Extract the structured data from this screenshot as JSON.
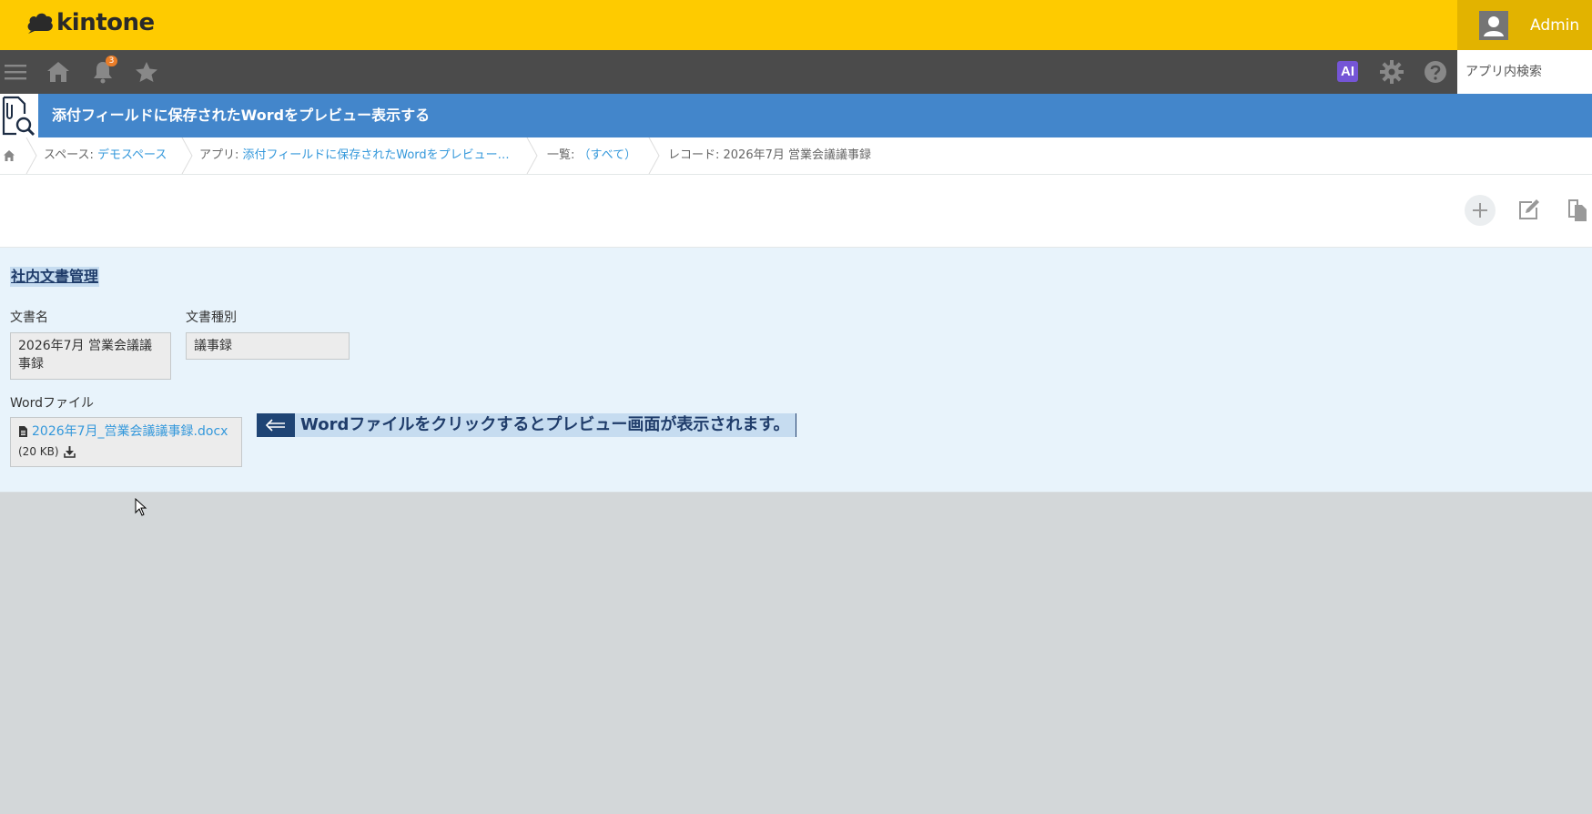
{
  "header": {
    "logo_text": "kintone",
    "user_name": "Admin"
  },
  "globalnav": {
    "notification_count": "3",
    "ai_label": "AI",
    "search_placeholder": "アプリ内検索"
  },
  "app": {
    "title": "添付フィールドに保存されたWordをプレビュー表示する"
  },
  "breadcrumb": {
    "space_prefix": "スペース: ",
    "space_name": "デモスペース",
    "app_prefix": "アプリ: ",
    "app_name": "添付フィールドに保存されたWordをプレビュー…",
    "list_prefix": "一覧: ",
    "list_name": "（すべて）",
    "record_label": "レコード: 2026年7月 営業会議議事録"
  },
  "record": {
    "group_title": "社内文書管理",
    "fields": {
      "doc_name_label": "文書名",
      "doc_name_value": "2026年7月 営業会議議事録",
      "doc_type_label": "文書種別",
      "doc_type_value": "議事録",
      "word_file_label": "Wordファイル",
      "word_file_name": "2026年7月_営業会議議事録.docx",
      "word_file_size": "(20 KB)"
    },
    "hint_text": "Wordファイルをクリックするとプレビュー画面が表示されます。"
  },
  "colors": {
    "header_yellow": "#fecb00",
    "nav_gray": "#4b4b4b",
    "app_blue": "#4386cb",
    "link_blue": "#3498db",
    "record_bg": "#e8f3fb",
    "hint_dark": "#1f4474"
  },
  "icons": [
    "menu-icon",
    "home-icon",
    "bell-icon",
    "star-icon",
    "gear-icon",
    "help-icon",
    "plus-icon",
    "edit-icon",
    "copy-icon",
    "file-icon",
    "download-icon",
    "arrow-left-icon"
  ]
}
